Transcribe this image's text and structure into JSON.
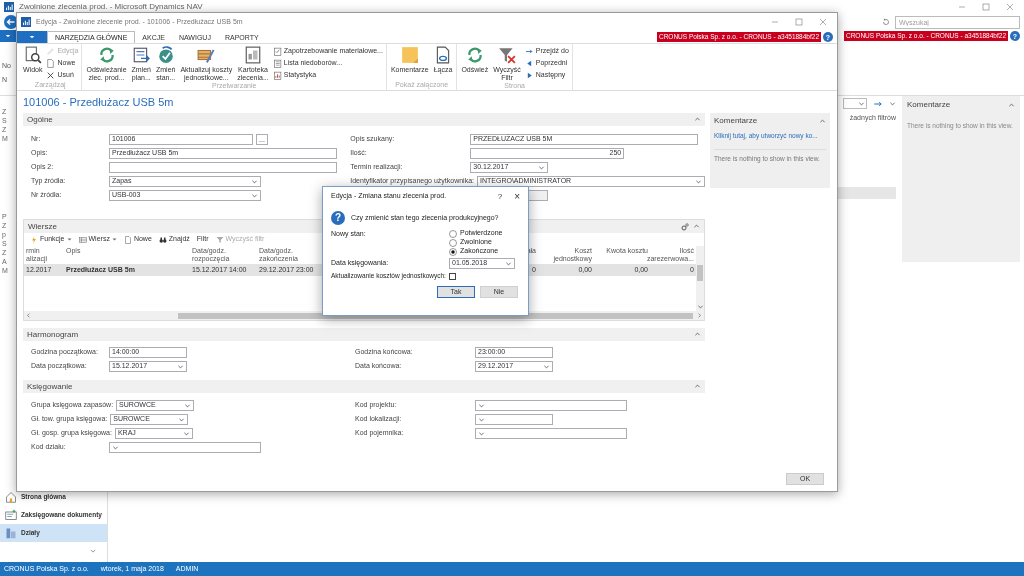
{
  "main_window": {
    "title": "Zwolnione zlecenia prod. - Microsoft Dynamics NAV",
    "search": {
      "placeholder": "Wyszukaj"
    },
    "company_badge": "CRONUS Polska Sp. z o.o. - CRONUS - a3451884bf22",
    "help": "?",
    "ribbon_fragments": [
      "No",
      "N"
    ],
    "tree_fragments": [
      "Z",
      "S",
      "Z",
      "M"
    ],
    "tree_fragments_2": [
      "P",
      "Z",
      "p",
      "S",
      "Z",
      "A",
      "M"
    ],
    "filter_note": "żadnych filtrów",
    "factbox": {
      "title": "Komentarze",
      "empty_text": "There is nothing to show in this view."
    },
    "nav": [
      {
        "label": "Strona główna",
        "selected": false
      },
      {
        "label": "Zaksięgowane dokumenty",
        "selected": false
      },
      {
        "label": "Działy",
        "selected": true
      }
    ]
  },
  "card_window": {
    "title": "Edycja - Zwolnione zlecenie prod. - 101006 - Przedłużacz USB 5m",
    "company_badge": "CRONUS Polska Sp. z o.o. - CRONUS - a3451884bf22",
    "help": "?",
    "ribbon_tabs": [
      {
        "label": "NARZĘDZIA GŁÓWNE",
        "selected": true
      },
      {
        "label": "AKCJE",
        "selected": false
      },
      {
        "label": "NAWIGUJ",
        "selected": false
      },
      {
        "label": "RAPORTY",
        "selected": false
      }
    ],
    "ribbon_groups": [
      {
        "label": "Zarządzaj",
        "items": [
          {
            "kind": "large",
            "lines": [
              "Widok"
            ],
            "disabled": false
          },
          {
            "kind": "small",
            "lines": [
              "Edycja"
            ],
            "disabled": true
          },
          {
            "kind": "small",
            "lines": [
              "Nowe"
            ],
            "disabled": false
          },
          {
            "kind": "small",
            "lines": [
              "Usuń"
            ],
            "disabled": false
          }
        ]
      },
      {
        "label": "Przetwarzanie",
        "items": [
          {
            "kind": "large",
            "lines": [
              "Odświeżanie",
              "zlec. prod..."
            ],
            "disabled": false
          },
          {
            "kind": "large",
            "lines": [
              "Zmień",
              "plan..."
            ],
            "disabled": false
          },
          {
            "kind": "large",
            "lines": [
              "Zmień",
              "stan..."
            ],
            "disabled": false
          },
          {
            "kind": "large",
            "lines": [
              "Aktualizuj koszty",
              "jednostkowe..."
            ],
            "disabled": false
          },
          {
            "kind": "large",
            "lines": [
              "Kartoteka",
              "zlecenia..."
            ],
            "disabled": false
          },
          {
            "kind": "small",
            "lines": [
              "Zapotrzebowanie materiałowe..."
            ],
            "disabled": false
          },
          {
            "kind": "small",
            "lines": [
              "Lista niedoborów..."
            ],
            "disabled": false
          },
          {
            "kind": "small",
            "lines": [
              "Statystyka"
            ],
            "disabled": false
          }
        ]
      },
      {
        "label": "Pokaż załączone",
        "items": [
          {
            "kind": "large",
            "lines": [
              "Komentarze"
            ],
            "disabled": false
          },
          {
            "kind": "large",
            "lines": [
              "Łącza"
            ],
            "disabled": false
          }
        ]
      },
      {
        "label": "Strona",
        "items": [
          {
            "kind": "large",
            "lines": [
              "Odśwież"
            ],
            "disabled": false
          },
          {
            "kind": "large",
            "lines": [
              "Wyczyść",
              "Filtr"
            ],
            "disabled": false
          },
          {
            "kind": "small",
            "lines": [
              "Przejdź do"
            ],
            "disabled": false
          },
          {
            "kind": "small",
            "lines": [
              "Poprzedni"
            ],
            "disabled": false
          },
          {
            "kind": "small",
            "lines": [
              "Następny"
            ],
            "disabled": false
          }
        ]
      }
    ],
    "page_title": "101006 - Przedłużacz USB 5m",
    "sections": [
      {
        "kind": "fields",
        "title": "Ogólne",
        "left": [
          {
            "label": "Nr:",
            "value": "101006",
            "kind": "lookup",
            "assist_button": "..."
          },
          {
            "label": "Opis:",
            "value": "Przedłużacz USB 5m",
            "kind": "text"
          },
          {
            "label": "Opis 2:",
            "kind": "text"
          },
          {
            "label": "Typ źródła:",
            "value": "Zapas",
            "kind": "dropdown"
          },
          {
            "label": "Nr źródła:",
            "value": "USB-003",
            "kind": "dropdown"
          }
        ],
        "right": [
          {
            "label": "Opis szukany:",
            "value": "PRZEDŁUŻACZ USB 5M",
            "kind": "text"
          },
          {
            "label": "Ilość:",
            "value": "250",
            "kind": "number"
          },
          {
            "label": "Termin realizacji:",
            "value": "30.12.2017",
            "kind": "dropdown"
          },
          {
            "label": "Identyfikator przypisanego użytkownika:",
            "value": "INTEGRO\\ADMINISTRATOR",
            "kind": "dropdown"
          },
          {
            "kind": "readonly"
          }
        ]
      },
      {
        "kind": "lines",
        "title": "Wiersze",
        "toolbar": [
          {
            "label": "Funkcje",
            "menu": true,
            "disabled": false
          },
          {
            "label": "Wiersz",
            "menu": true,
            "disabled": false
          },
          {
            "label": "Nowe",
            "menu": false,
            "disabled": false
          },
          {
            "label": "Znajdź",
            "menu": false,
            "disabled": false
          },
          {
            "label": "Filtr",
            "menu": false,
            "disabled": false
          },
          {
            "label": "Wyczyść filtr",
            "menu": false,
            "disabled": true
          }
        ],
        "columns": [
          "rmin alizacji",
          "Opis",
          "Data/godz. rozpoczęcia",
          "Data/godz. zakończenia",
          "ała",
          "Koszt jednostkowy",
          "Kwota kosztu",
          "Ilość zarezerwowa..."
        ],
        "rows": [
          {
            "selected": true,
            "cells": [
              "12.2017",
              "Przedłużacz USB 5m",
              "15.12.2017 14:00",
              "29.12.2017 23:00",
              "0",
              "0,00",
              "0,00",
              "0"
            ]
          }
        ]
      },
      {
        "kind": "fields",
        "title": "Harmonogram",
        "left": [
          {
            "label": "Godzina początkowa:",
            "value": "14:00:00",
            "kind": "text"
          },
          {
            "label": "Data początkowa:",
            "value": "15.12.2017",
            "kind": "dropdown"
          }
        ],
        "right": [
          {
            "label": "Godzina końcowa:",
            "value": "23:00:00",
            "kind": "text"
          },
          {
            "label": "Data końcowa:",
            "value": "29.12.2017",
            "kind": "dropdown"
          }
        ]
      },
      {
        "kind": "fields",
        "title": "Księgowanie",
        "left": [
          {
            "label": "Grupa księgowa zapasów:",
            "value": "SUROWCE",
            "kind": "dropdown"
          },
          {
            "label": "Gł. tow. grupa księgowa:",
            "value": "SUROWCE",
            "kind": "dropdown"
          },
          {
            "label": "Gł. gosp. grupa księgowa:",
            "value": "KRAJ",
            "kind": "dropdown"
          },
          {
            "label": "Kod działu:",
            "kind": "dropdown"
          }
        ],
        "right": [
          {
            "label": "Kod projektu:",
            "kind": "dropdown"
          },
          {
            "label": "Kod lokalizacji:",
            "kind": "dropdown"
          },
          {
            "label": "Kod pojemnika:",
            "kind": "dropdown"
          }
        ]
      }
    ],
    "factbox": {
      "title": "Komentarze",
      "link": "Kliknij tutaj, aby utworzyć nowy ko...",
      "empty_text": "There is nothing to show in this view."
    },
    "ok_button": "OK"
  },
  "dialog": {
    "title": "Edycja - Zmiana stanu zlecenia prod.",
    "help": "?",
    "close": "×",
    "question_icon": "?",
    "question": "Czy zmienić stan tego zlecenia produkcyjnego?",
    "status_label": "Nowy stan:",
    "options": [
      {
        "label": "Potwierdzone",
        "selected": false
      },
      {
        "label": "Zwolnione",
        "selected": false
      },
      {
        "label": "Zakończone",
        "selected": true
      }
    ],
    "posting_date": {
      "label": "Data księgowania:",
      "value": "01.05.2018"
    },
    "update_costs": {
      "label": "Aktualizowanie kosztów jednostkowych:",
      "checked": false
    },
    "buttons": [
      {
        "label": "Tak",
        "default": true
      },
      {
        "label": "Nie",
        "default": false
      }
    ]
  },
  "status_bar": [
    "CRONUS Polska Sp. z o.o.",
    "wtorek, 1 maja 2018",
    "ADMIN"
  ]
}
